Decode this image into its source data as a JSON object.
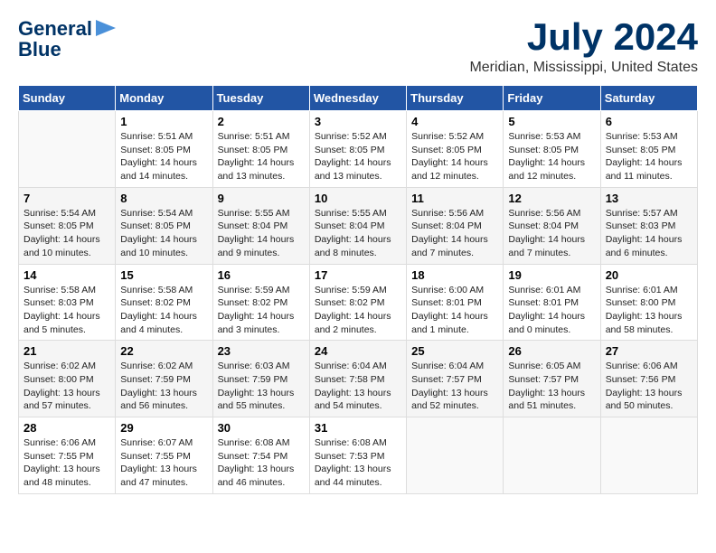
{
  "logo": {
    "line1": "General",
    "line2": "Blue"
  },
  "title": "July 2024",
  "subtitle": "Meridian, Mississippi, United States",
  "days_of_week": [
    "Sunday",
    "Monday",
    "Tuesday",
    "Wednesday",
    "Thursday",
    "Friday",
    "Saturday"
  ],
  "weeks": [
    [
      {
        "day": "",
        "content": ""
      },
      {
        "day": "1",
        "content": "Sunrise: 5:51 AM\nSunset: 8:05 PM\nDaylight: 14 hours\nand 14 minutes."
      },
      {
        "day": "2",
        "content": "Sunrise: 5:51 AM\nSunset: 8:05 PM\nDaylight: 14 hours\nand 13 minutes."
      },
      {
        "day": "3",
        "content": "Sunrise: 5:52 AM\nSunset: 8:05 PM\nDaylight: 14 hours\nand 13 minutes."
      },
      {
        "day": "4",
        "content": "Sunrise: 5:52 AM\nSunset: 8:05 PM\nDaylight: 14 hours\nand 12 minutes."
      },
      {
        "day": "5",
        "content": "Sunrise: 5:53 AM\nSunset: 8:05 PM\nDaylight: 14 hours\nand 12 minutes."
      },
      {
        "day": "6",
        "content": "Sunrise: 5:53 AM\nSunset: 8:05 PM\nDaylight: 14 hours\nand 11 minutes."
      }
    ],
    [
      {
        "day": "7",
        "content": "Sunrise: 5:54 AM\nSunset: 8:05 PM\nDaylight: 14 hours\nand 10 minutes."
      },
      {
        "day": "8",
        "content": "Sunrise: 5:54 AM\nSunset: 8:05 PM\nDaylight: 14 hours\nand 10 minutes."
      },
      {
        "day": "9",
        "content": "Sunrise: 5:55 AM\nSunset: 8:04 PM\nDaylight: 14 hours\nand 9 minutes."
      },
      {
        "day": "10",
        "content": "Sunrise: 5:55 AM\nSunset: 8:04 PM\nDaylight: 14 hours\nand 8 minutes."
      },
      {
        "day": "11",
        "content": "Sunrise: 5:56 AM\nSunset: 8:04 PM\nDaylight: 14 hours\nand 7 minutes."
      },
      {
        "day": "12",
        "content": "Sunrise: 5:56 AM\nSunset: 8:04 PM\nDaylight: 14 hours\nand 7 minutes."
      },
      {
        "day": "13",
        "content": "Sunrise: 5:57 AM\nSunset: 8:03 PM\nDaylight: 14 hours\nand 6 minutes."
      }
    ],
    [
      {
        "day": "14",
        "content": "Sunrise: 5:58 AM\nSunset: 8:03 PM\nDaylight: 14 hours\nand 5 minutes."
      },
      {
        "day": "15",
        "content": "Sunrise: 5:58 AM\nSunset: 8:02 PM\nDaylight: 14 hours\nand 4 minutes."
      },
      {
        "day": "16",
        "content": "Sunrise: 5:59 AM\nSunset: 8:02 PM\nDaylight: 14 hours\nand 3 minutes."
      },
      {
        "day": "17",
        "content": "Sunrise: 5:59 AM\nSunset: 8:02 PM\nDaylight: 14 hours\nand 2 minutes."
      },
      {
        "day": "18",
        "content": "Sunrise: 6:00 AM\nSunset: 8:01 PM\nDaylight: 14 hours\nand 1 minute."
      },
      {
        "day": "19",
        "content": "Sunrise: 6:01 AM\nSunset: 8:01 PM\nDaylight: 14 hours\nand 0 minutes."
      },
      {
        "day": "20",
        "content": "Sunrise: 6:01 AM\nSunset: 8:00 PM\nDaylight: 13 hours\nand 58 minutes."
      }
    ],
    [
      {
        "day": "21",
        "content": "Sunrise: 6:02 AM\nSunset: 8:00 PM\nDaylight: 13 hours\nand 57 minutes."
      },
      {
        "day": "22",
        "content": "Sunrise: 6:02 AM\nSunset: 7:59 PM\nDaylight: 13 hours\nand 56 minutes."
      },
      {
        "day": "23",
        "content": "Sunrise: 6:03 AM\nSunset: 7:59 PM\nDaylight: 13 hours\nand 55 minutes."
      },
      {
        "day": "24",
        "content": "Sunrise: 6:04 AM\nSunset: 7:58 PM\nDaylight: 13 hours\nand 54 minutes."
      },
      {
        "day": "25",
        "content": "Sunrise: 6:04 AM\nSunset: 7:57 PM\nDaylight: 13 hours\nand 52 minutes."
      },
      {
        "day": "26",
        "content": "Sunrise: 6:05 AM\nSunset: 7:57 PM\nDaylight: 13 hours\nand 51 minutes."
      },
      {
        "day": "27",
        "content": "Sunrise: 6:06 AM\nSunset: 7:56 PM\nDaylight: 13 hours\nand 50 minutes."
      }
    ],
    [
      {
        "day": "28",
        "content": "Sunrise: 6:06 AM\nSunset: 7:55 PM\nDaylight: 13 hours\nand 48 minutes."
      },
      {
        "day": "29",
        "content": "Sunrise: 6:07 AM\nSunset: 7:55 PM\nDaylight: 13 hours\nand 47 minutes."
      },
      {
        "day": "30",
        "content": "Sunrise: 6:08 AM\nSunset: 7:54 PM\nDaylight: 13 hours\nand 46 minutes."
      },
      {
        "day": "31",
        "content": "Sunrise: 6:08 AM\nSunset: 7:53 PM\nDaylight: 13 hours\nand 44 minutes."
      },
      {
        "day": "",
        "content": ""
      },
      {
        "day": "",
        "content": ""
      },
      {
        "day": "",
        "content": ""
      }
    ]
  ]
}
